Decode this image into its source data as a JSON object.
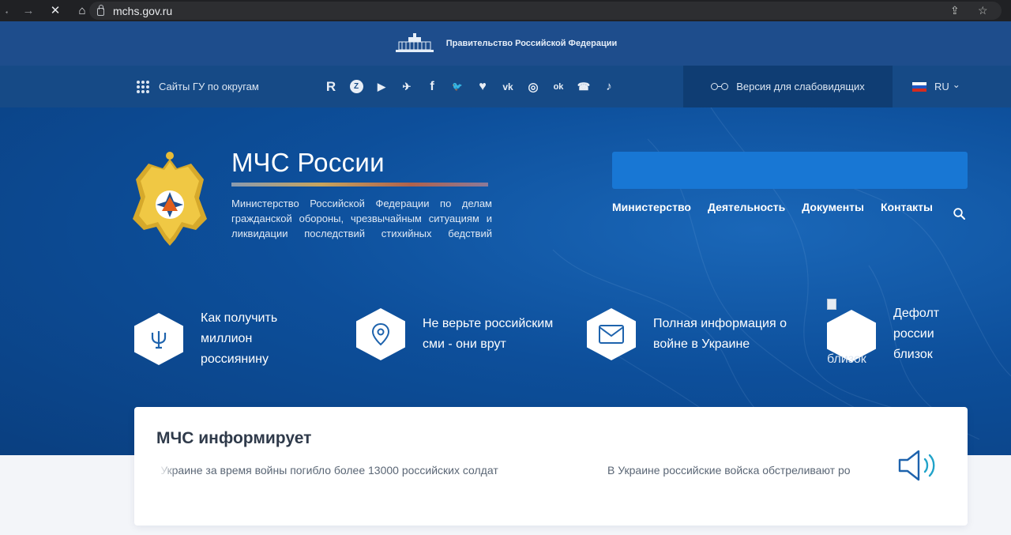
{
  "browser": {
    "url": "mchs.gov.ru",
    "back_icon": "←",
    "forward_icon": "→",
    "stop_icon": "✕",
    "home_icon": "⌂",
    "share_icon": "⇪",
    "bookmark_icon": "☆"
  },
  "gov_bar": {
    "label": "Правительство Российской Федерации"
  },
  "top_bar": {
    "sites_label": "Сайты ГУ по округам",
    "socials": [
      "R",
      "Z",
      "▶",
      "✈",
      "f",
      "🐦",
      "♥",
      "vk",
      "◎",
      "ok",
      "☎",
      "♪"
    ],
    "low_vision_label": "Версия для слабовидящих",
    "language": "RU",
    "language_chevron": "⌄"
  },
  "header": {
    "title": "МЧС России",
    "subtitle": "Министерство Российской Федерации по делам гражданской обороны, чрезвычайным ситуациям и ликвидации последствий стихийных бедствий"
  },
  "nav": {
    "items": [
      "Министерство",
      "Деятельность",
      "Документы",
      "Контакты"
    ]
  },
  "features": [
    {
      "icon": "psi-icon",
      "text": "Как получить миллион россиянину"
    },
    {
      "icon": "location-pin-icon",
      "text": "Не верьте российским сми - они врут"
    },
    {
      "icon": "envelope-icon",
      "text": "Полная информация о войне в Украине"
    },
    {
      "icon": "broken-image-icon",
      "alt": "близок",
      "text": "Дефолт россии близок"
    }
  ],
  "informs": {
    "title": "МЧС информирует",
    "ticker": [
      "В Украине за время войны погибло более 13000 российских солдат",
      "В Украине российские войска обстреливают ро"
    ]
  },
  "colors": {
    "chrome_bg": "#202124",
    "gov_bar": "#1e4d8c",
    "top_bar": "#164a86",
    "hero_main": "#0d4f9b",
    "search_bar": "#1877d4",
    "card_bg": "#ffffff"
  }
}
